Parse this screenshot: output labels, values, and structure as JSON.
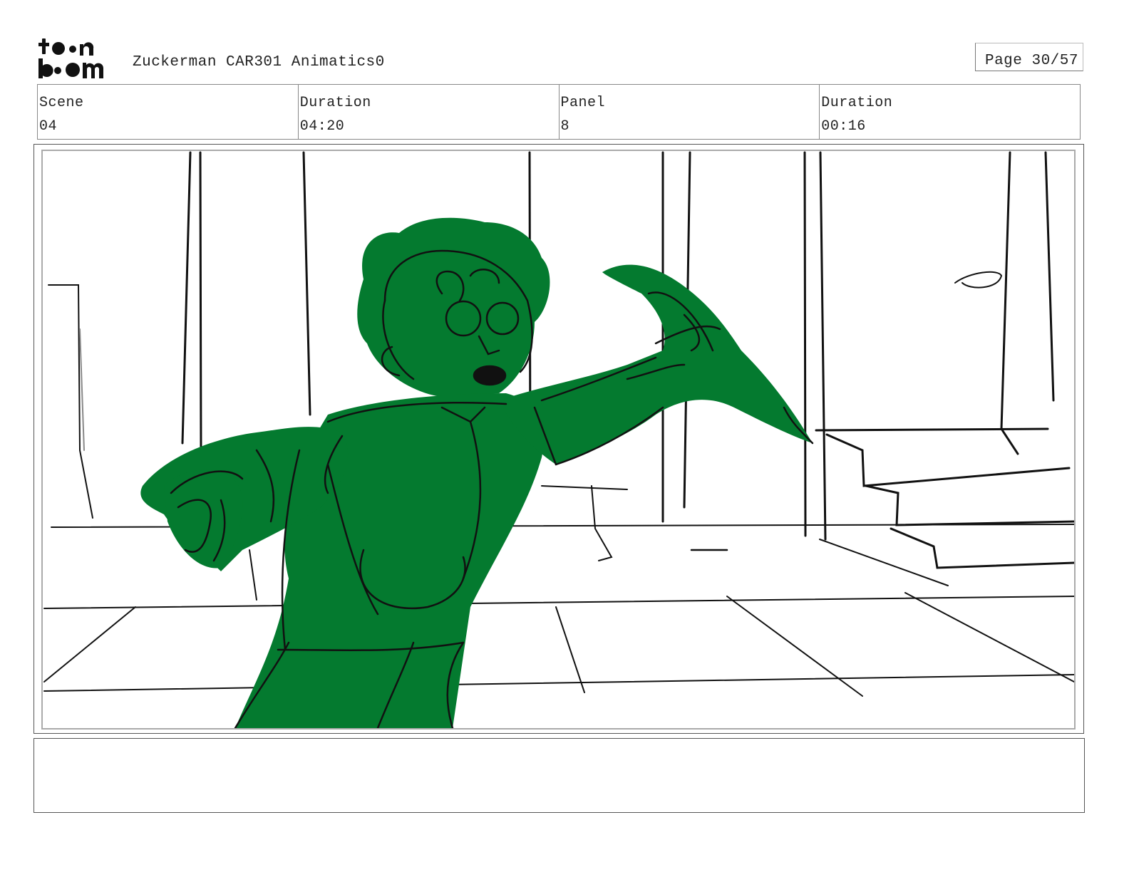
{
  "header": {
    "logo_alt": "toon boom",
    "title": "Zuckerman CAR301 Animatics0",
    "page_label": "Page 30/57"
  },
  "info": [
    {
      "label": "Scene",
      "value": "04"
    },
    {
      "label": "Duration",
      "value": "04:20"
    },
    {
      "label": "Panel",
      "value": "8"
    },
    {
      "label": "Duration",
      "value": "00:16"
    }
  ],
  "panel": {
    "fill_color": "#047a2f",
    "line_color": "#111111"
  },
  "notes": {
    "text": ""
  }
}
